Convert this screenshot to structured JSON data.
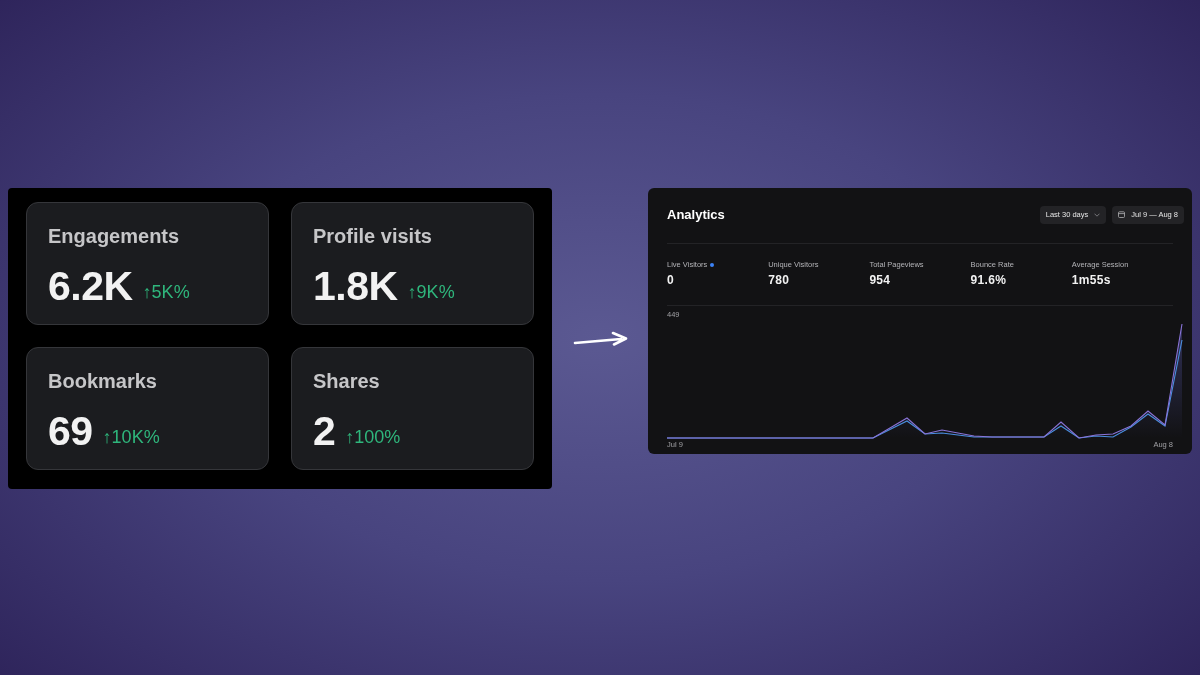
{
  "stats_panel": {
    "cards": [
      {
        "label": "Engagements",
        "value": "6.2K",
        "change": "↑5K%"
      },
      {
        "label": "Profile visits",
        "value": "1.8K",
        "change": "↑9K%"
      },
      {
        "label": "Bookmarks",
        "value": "69",
        "change": "↑10K%"
      },
      {
        "label": "Shares",
        "value": "2",
        "change": "↑100%"
      }
    ]
  },
  "analytics": {
    "title": "Analytics",
    "range_button": "Last 30 days",
    "date_button": "Jul 9 — Aug 8",
    "stats": [
      {
        "label": "Live Visitors",
        "value": "0",
        "live": true
      },
      {
        "label": "Unique Visitors",
        "value": "780",
        "live": false
      },
      {
        "label": "Total Pageviews",
        "value": "954",
        "live": false
      },
      {
        "label": "Bounce Rate",
        "value": "91.6%",
        "live": false
      },
      {
        "label": "Average Session",
        "value": "1m55s",
        "live": false
      }
    ],
    "chart": {
      "y_top_label": "449",
      "x_labels": [
        "Jul 9",
        "Aug 8"
      ]
    }
  }
}
